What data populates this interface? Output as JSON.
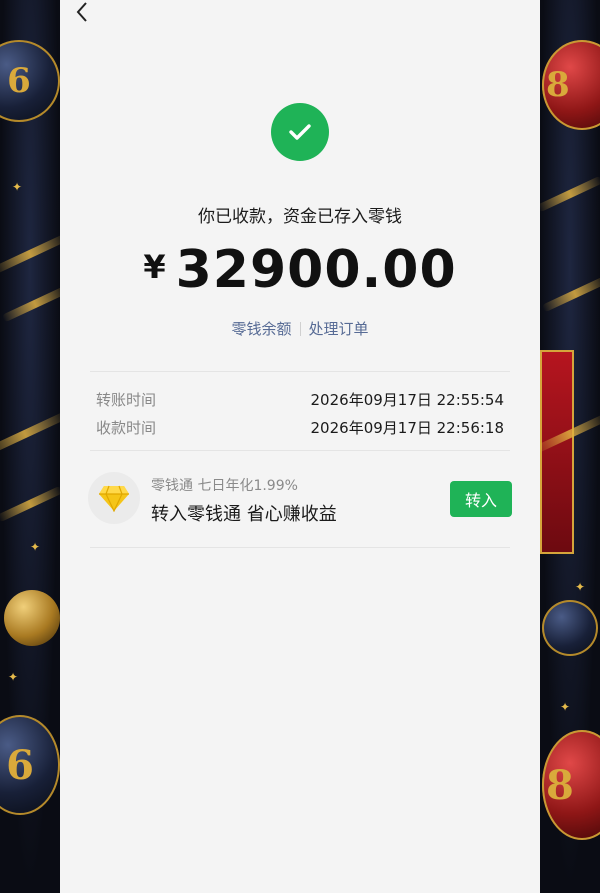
{
  "nav": {
    "back_icon": "chevron-left-icon"
  },
  "status": {
    "icon": "check-circle-icon",
    "color": "#1fb357",
    "text": "你已收款，资金已存入零钱"
  },
  "amount": {
    "currency": "¥",
    "value": "32900.00"
  },
  "links": {
    "balance": "零钱余额",
    "order": "处理订单",
    "color": "#576b95"
  },
  "details": {
    "transfer_time_label": "转账时间",
    "transfer_time_value": "2026年09月17日 22:55:54",
    "receive_time_label": "收款时间",
    "receive_time_value": "2026年09月17日 22:56:18"
  },
  "promo": {
    "icon": "diamond-icon",
    "subtitle": "零钱通 七日年化1.99%",
    "title": "转入零钱通 省心赚收益",
    "button": "转入",
    "button_color": "#1fb357"
  },
  "background": {
    "ball_numbers": [
      "6",
      "8",
      "6",
      "8"
    ]
  }
}
